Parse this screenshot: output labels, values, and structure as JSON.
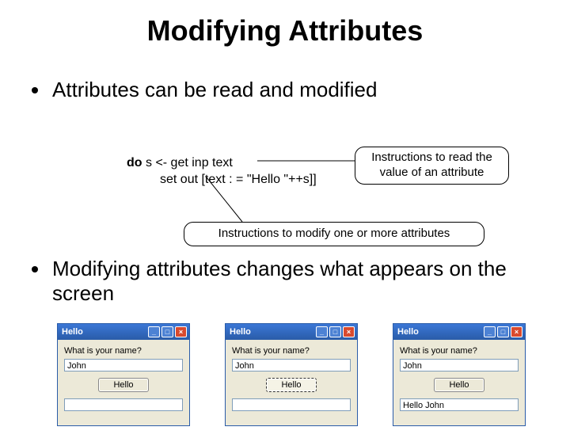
{
  "slide": {
    "title": "Modifying Attributes",
    "bullet1": "Attributes can be read and modified",
    "bullet2": "Modifying attributes changes what appears on the screen"
  },
  "code": {
    "kw": "do",
    "line1_rest": " s <- get inp text",
    "line2": "set out [text : = \"Hello \"++s]]"
  },
  "callouts": {
    "c1": "Instructions to read the value of an attribute",
    "c2": "Instructions to modify one or more attributes"
  },
  "windows": {
    "title": "Hello",
    "prompt": "What is your name?",
    "button_label": "Hello",
    "btn_min": "_",
    "btn_max": "□",
    "btn_close": "×",
    "w1": {
      "input_value": "John",
      "output_value": ""
    },
    "w2": {
      "input_value": "John",
      "output_value": ""
    },
    "w3": {
      "input_value": "John",
      "output_value": "Hello John"
    }
  }
}
